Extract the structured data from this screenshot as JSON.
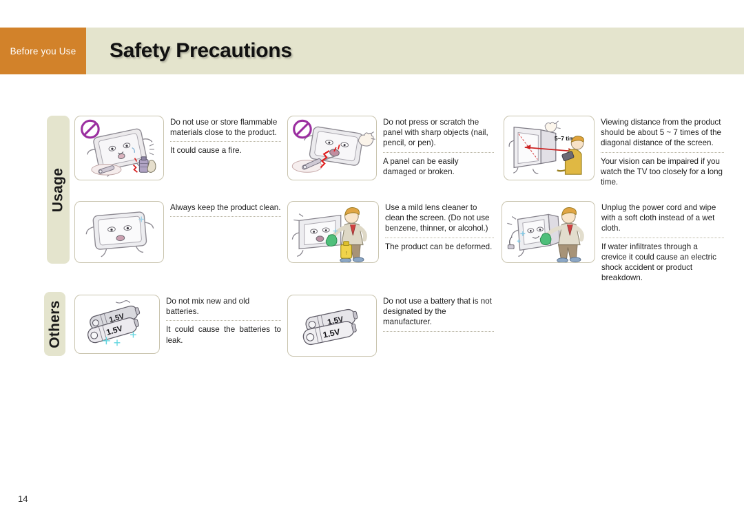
{
  "header": {
    "tab_label": "Before you Use",
    "title": "Safety Precautions",
    "tab_color": "#d2822a",
    "band_color": "#e4e4cd"
  },
  "side_tabs": [
    {
      "label": "Usage"
    },
    {
      "label": "Others"
    }
  ],
  "items": [
    {
      "id": "flammable-materials",
      "section": "Usage",
      "warning": "Do not use or store flammable materials close to the product.",
      "consequence": "It could cause a fire.",
      "icon": "prohibition-sign",
      "illustration": "tv-with-flammable-spray-can"
    },
    {
      "id": "sharp-objects",
      "section": "Usage",
      "warning": "Do not press or scratch the panel with sharp objects (nail, pencil, or pen).",
      "consequence": "A panel can be easily damaged or broken.",
      "icon": "prohibition-sign",
      "illustration": "tv-scratched-by-pen"
    },
    {
      "id": "viewing-distance",
      "section": "Usage",
      "warning": "Viewing distance from the product should be about 5 ~ 7 times of the diagonal distance of the screen.",
      "consequence": "Your vision can be impaired if you watch the TV too closely for a long time.",
      "illustration": "person-watching-tv-at-distance",
      "annotation": "5~7 times"
    },
    {
      "id": "keep-clean",
      "section": "Usage",
      "warning": "Always keep the product clean.",
      "consequence": "",
      "illustration": "clean-tv-with-face"
    },
    {
      "id": "mild-lens-cleaner",
      "section": "Usage",
      "warning": "Use a mild lens cleaner to clean the screen. (Do not use benzene, thinner, or alcohol.)",
      "consequence": "The product can be deformed.",
      "illustration": "man-cleaning-tv-with-cleaner-bottle"
    },
    {
      "id": "unplug-before-wiping",
      "section": "Usage",
      "warning": "Unplug the power cord and wipe with a soft cloth instead of a wet cloth.",
      "consequence": "If water infiltrates through a crevice it could cause an electric shock accident or product breakdown.",
      "illustration": "man-wiping-unplugged-tv"
    },
    {
      "id": "mix-new-old-batteries",
      "section": "Others",
      "warning": "Do not mix new and old batteries.",
      "consequence": "It could cause the batteries to leak.",
      "illustration": "two-batteries-leaking",
      "battery_labels": [
        "1.5V",
        "1.5V"
      ]
    },
    {
      "id": "non-designated-battery",
      "section": "Others",
      "warning": "Do not use a battery that is not designated by the manufacturer.",
      "consequence": "",
      "illustration": "two-batteries",
      "battery_labels": [
        "1.5V",
        "1.5V"
      ]
    }
  ],
  "footer": {
    "page_number": "14"
  }
}
